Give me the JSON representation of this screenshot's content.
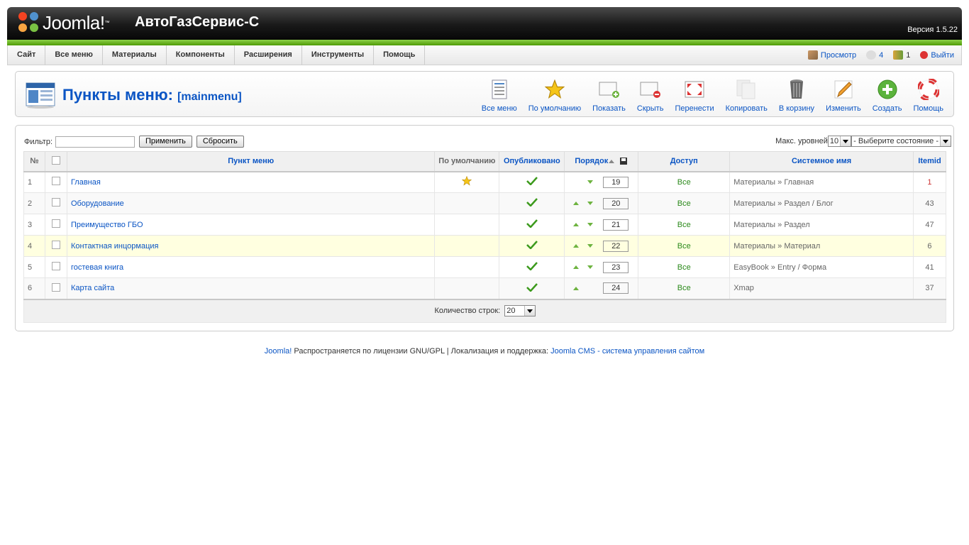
{
  "header": {
    "logo_text": "Joomla!",
    "tm": "™",
    "site_name": "АвтоГазСервис-С",
    "version": "Версия 1.5.22"
  },
  "menu": [
    "Сайт",
    "Все меню",
    "Материалы",
    "Компоненты",
    "Расширения",
    "Инструменты",
    "Помощь"
  ],
  "status": {
    "preview": "Просмотр",
    "messages": "4",
    "users": "1",
    "logout": "Выйти"
  },
  "page": {
    "title": "Пункты меню:",
    "subtitle": "[mainmenu]"
  },
  "toolbar": [
    "Все меню",
    "По умолчанию",
    "Показать",
    "Скрыть",
    "Перенести",
    "Копировать",
    "В корзину",
    "Изменить",
    "Создать",
    "Помощь"
  ],
  "filter": {
    "label": "Фильтр:",
    "value": "",
    "apply": "Применить",
    "reset": "Сбросить",
    "max_levels_label": "Макс. уровней",
    "max_levels": "10",
    "state": "- Выберите состояние -"
  },
  "table": {
    "headers": {
      "num": "№",
      "item": "Пункт меню",
      "default": "По умолчанию",
      "published": "Опубликовано",
      "order": "Порядок",
      "access": "Доступ",
      "sysname": "Системное имя",
      "itemid": "Itemid"
    },
    "rows": [
      {
        "num": "1",
        "name": "Главная",
        "default": true,
        "published": true,
        "up": false,
        "down": true,
        "order": "19",
        "access": "Все",
        "sysname": "Материалы » Главная",
        "itemid": "1"
      },
      {
        "num": "2",
        "name": "Оборудование",
        "default": false,
        "published": true,
        "up": true,
        "down": true,
        "order": "20",
        "access": "Все",
        "sysname": "Материалы » Раздел / Блог",
        "itemid": "43"
      },
      {
        "num": "3",
        "name": "Преимущество ГБО",
        "default": false,
        "published": true,
        "up": true,
        "down": true,
        "order": "21",
        "access": "Все",
        "sysname": "Материалы » Раздел",
        "itemid": "47"
      },
      {
        "num": "4",
        "name": "Контактная инцормация",
        "default": false,
        "published": true,
        "up": true,
        "down": true,
        "order": "22",
        "access": "Все",
        "sysname": "Материалы » Материал",
        "itemid": "6"
      },
      {
        "num": "5",
        "name": "гостевая книга",
        "default": false,
        "published": true,
        "up": true,
        "down": true,
        "order": "23",
        "access": "Все",
        "sysname": "EasyBook » Entry / Форма",
        "itemid": "41"
      },
      {
        "num": "6",
        "name": "Карта сайта",
        "default": false,
        "published": true,
        "up": true,
        "down": false,
        "order": "24",
        "access": "Все",
        "sysname": "Xmap",
        "itemid": "37"
      }
    ],
    "footer_label": "Количество строк:",
    "rows_per_page": "20"
  },
  "footer": {
    "joomla": "Joomla!",
    "text": " Распространяется по лицензии GNU/GPL | Локализация и поддержка: ",
    "link": "Joomla CMS - система управления сайтом"
  }
}
